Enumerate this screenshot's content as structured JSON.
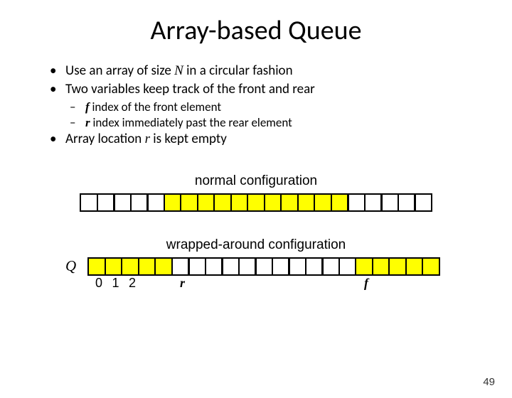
{
  "title": "Array-based Queue",
  "bullets": {
    "b1_pre": "Use an array of size ",
    "b1_N": "N",
    "b1_post": " in a circular fashion",
    "b2": "Two variables keep track of the front and rear",
    "b2a_var": "f",
    "b2a_text": "  index of the front element",
    "b2b_var": "r",
    "b2b_text": "  index immediately past the rear element",
    "b3_pre": "Array location ",
    "b3_var": "r",
    "b3_post": " is kept empty"
  },
  "config1_label": "normal configuration",
  "config2_label": "wrapped-around configuration",
  "q_label": "Q",
  "indices": {
    "i0": "0",
    "i1": "1",
    "i2": "2",
    "r": "r",
    "f": "f"
  },
  "page_num": "49",
  "chart_data": [
    {
      "type": "table",
      "title": "normal configuration",
      "cells_filled": [
        false,
        false,
        false,
        false,
        false,
        true,
        true,
        true,
        true,
        true,
        true,
        true,
        true,
        true,
        true,
        true,
        false,
        false,
        false,
        false,
        false
      ]
    },
    {
      "type": "table",
      "title": "wrapped-around configuration",
      "cells_filled": [
        true,
        true,
        true,
        true,
        true,
        false,
        false,
        false,
        false,
        false,
        false,
        false,
        false,
        false,
        false,
        false,
        true,
        true,
        true,
        true,
        true
      ],
      "index_labels": [
        "0",
        "1",
        "2",
        "",
        "",
        "r",
        "",
        "",
        "",
        "",
        "",
        "",
        "",
        "",
        "",
        "",
        "f",
        "",
        "",
        "",
        ""
      ]
    }
  ]
}
